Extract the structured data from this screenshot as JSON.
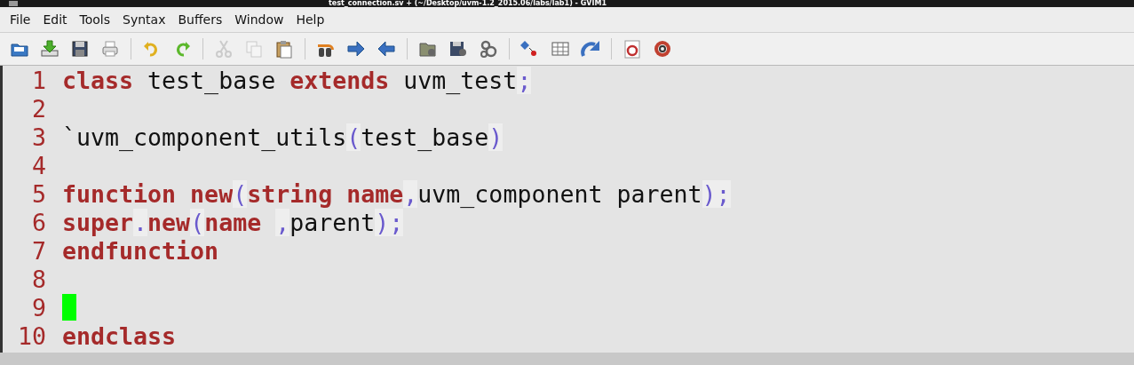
{
  "window": {
    "title": "test_connection.sv + (~/Desktop/uvm-1.2_2015.06/labs/lab1) - GVIM1"
  },
  "menu": [
    "File",
    "Edit",
    "Tools",
    "Syntax",
    "Buffers",
    "Window",
    "Help"
  ],
  "toolbar": [
    {
      "kind": "button",
      "disabled": false
    },
    {
      "kind": "button",
      "disabled": false
    },
    {
      "kind": "button",
      "disabled": false
    },
    {
      "kind": "button",
      "disabled": false
    },
    {
      "kind": "separator"
    },
    {
      "kind": "button",
      "disabled": false
    },
    {
      "kind": "button",
      "disabled": false
    },
    {
      "kind": "separator"
    },
    {
      "kind": "button",
      "disabled": true
    },
    {
      "kind": "button",
      "disabled": true
    },
    {
      "kind": "button",
      "disabled": false
    },
    {
      "kind": "separator"
    },
    {
      "kind": "button",
      "disabled": false
    },
    {
      "kind": "button",
      "disabled": false
    },
    {
      "kind": "button",
      "disabled": false
    },
    {
      "kind": "separator"
    },
    {
      "kind": "button",
      "disabled": false
    },
    {
      "kind": "button",
      "disabled": false
    },
    {
      "kind": "button",
      "disabled": false
    },
    {
      "kind": "separator"
    },
    {
      "kind": "button",
      "disabled": false
    },
    {
      "kind": "button",
      "disabled": false
    },
    {
      "kind": "button",
      "disabled": false
    },
    {
      "kind": "separator"
    },
    {
      "kind": "button",
      "disabled": false
    },
    {
      "kind": "button",
      "disabled": false
    }
  ],
  "editor": {
    "lines": [
      {
        "number": "1",
        "cursor": false,
        "tokens": [
          {
            "kind": "keyword",
            "text": "class"
          },
          {
            "kind": "text",
            "text": " test_base "
          },
          {
            "kind": "keyword",
            "text": "extends"
          },
          {
            "kind": "text",
            "text": " uvm_test"
          },
          {
            "kind": "punct",
            "text": ";"
          }
        ]
      },
      {
        "number": "2",
        "cursor": false
      },
      {
        "number": "3",
        "cursor": false,
        "tokens": [
          {
            "kind": "text",
            "text": "`uvm_component_utils"
          },
          {
            "kind": "punct",
            "text": "("
          },
          {
            "kind": "text",
            "text": "test_base"
          },
          {
            "kind": "punct",
            "text": ")"
          }
        ]
      },
      {
        "number": "4",
        "cursor": false
      },
      {
        "number": "5",
        "cursor": false,
        "tokens": [
          {
            "kind": "keyword",
            "text": "function "
          },
          {
            "kind": "keyword",
            "text": "new"
          },
          {
            "kind": "punct",
            "text": "("
          },
          {
            "kind": "keyword",
            "text": "string "
          },
          {
            "kind": "keyword",
            "text": "name"
          },
          {
            "kind": "punct",
            "text": ","
          },
          {
            "kind": "text",
            "text": "uvm_component parent"
          },
          {
            "kind": "punct",
            "text": ");"
          }
        ]
      },
      {
        "number": "6",
        "cursor": false,
        "tokens": [
          {
            "kind": "keyword",
            "text": "super"
          },
          {
            "kind": "punct",
            "text": "."
          },
          {
            "kind": "keyword",
            "text": "new"
          },
          {
            "kind": "punct",
            "text": "("
          },
          {
            "kind": "keyword",
            "text": "name "
          },
          {
            "kind": "punct",
            "text": ","
          },
          {
            "kind": "text",
            "text": "parent"
          },
          {
            "kind": "punct",
            "text": ");"
          }
        ]
      },
      {
        "number": "7",
        "cursor": false,
        "tokens": [
          {
            "kind": "keyword",
            "text": "endfunction"
          }
        ]
      },
      {
        "number": "8",
        "cursor": false
      },
      {
        "number": "9",
        "cursor": true
      },
      {
        "number": "10",
        "cursor": false,
        "tokens": [
          {
            "kind": "keyword",
            "text": "endclass"
          }
        ]
      }
    ]
  }
}
